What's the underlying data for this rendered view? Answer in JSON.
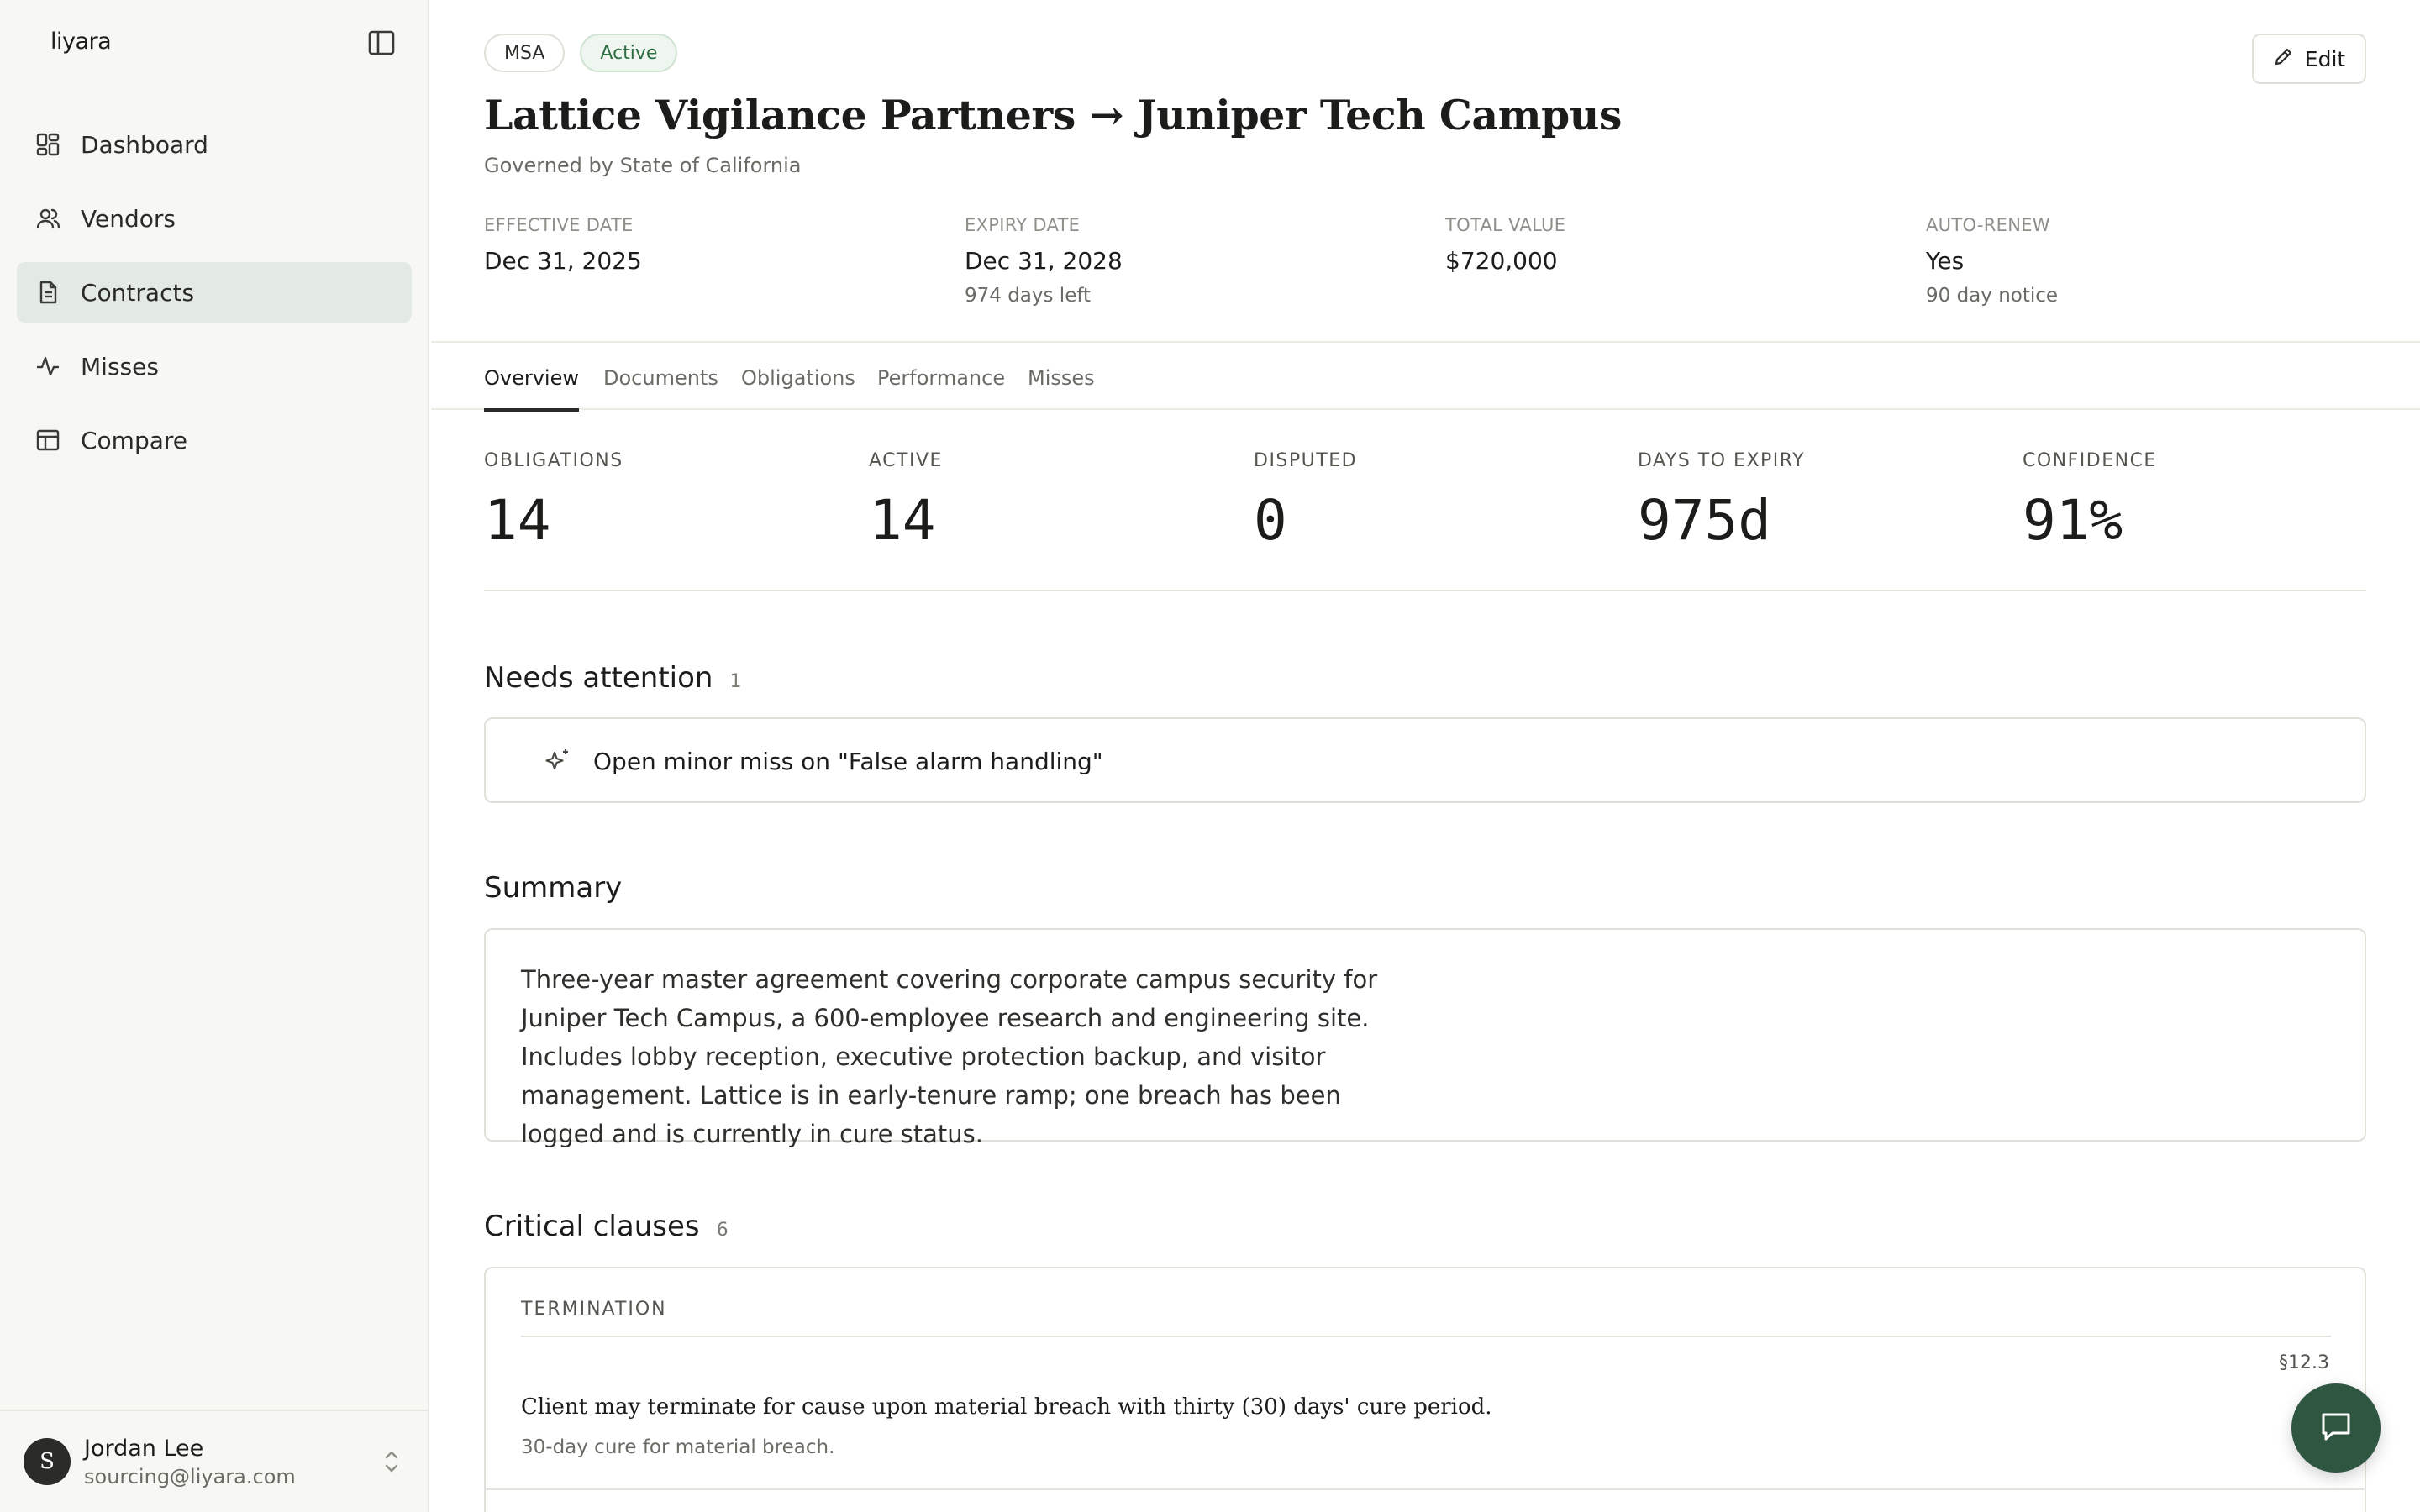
{
  "app": {
    "logo": "liyara"
  },
  "sidebar": {
    "items": [
      {
        "label": "Dashboard",
        "icon": "dashboard-icon"
      },
      {
        "label": "Vendors",
        "icon": "users-icon"
      },
      {
        "label": "Contracts",
        "icon": "document-icon",
        "active": true
      },
      {
        "label": "Misses",
        "icon": "activity-icon"
      },
      {
        "label": "Compare",
        "icon": "table-icon"
      }
    ],
    "user": {
      "initial": "S",
      "name": "Jordan Lee",
      "email": "sourcing@liyara.com"
    }
  },
  "header": {
    "badges": {
      "type": "MSA",
      "status": "Active"
    },
    "edit_label": "Edit",
    "title": "Lattice Vigilance Partners → Juniper Tech Campus",
    "subtitle": "Governed by State of California",
    "meta": {
      "effective": {
        "label": "EFFECTIVE DATE",
        "value": "Dec 31, 2025"
      },
      "expiry": {
        "label": "EXPIRY DATE",
        "value": "Dec 31, 2028",
        "sub": "974 days left"
      },
      "value": {
        "label": "TOTAL VALUE",
        "value": "$720,000"
      },
      "renew": {
        "label": "AUTO-RENEW",
        "value": "Yes",
        "sub": "90 day notice"
      }
    }
  },
  "tabs": [
    "Overview",
    "Documents",
    "Obligations",
    "Performance",
    "Misses"
  ],
  "stats": [
    {
      "label": "OBLIGATIONS",
      "value": "14"
    },
    {
      "label": "ACTIVE",
      "value": "14"
    },
    {
      "label": "DISPUTED",
      "value": "0"
    },
    {
      "label": "DAYS TO EXPIRY",
      "value": "975d"
    },
    {
      "label": "CONFIDENCE",
      "value": "91%"
    }
  ],
  "attention": {
    "title": "Needs attention",
    "count": "1",
    "item": "Open minor miss on \"False alarm handling\""
  },
  "summary": {
    "title": "Summary",
    "text": "Three-year master agreement covering corporate campus security for Juniper Tech Campus, a 600-employee research and engineering site. Includes lobby reception, executive protection backup, and visitor management. Lattice is in early-tenure ramp; one breach has been logged and is currently in cure status."
  },
  "clauses": {
    "title": "Critical clauses",
    "count": "6",
    "items": [
      {
        "kicker": "TERMINATION",
        "ref": "§12.3",
        "text": "Client may terminate for cause upon material breach with thirty (30) days' cure period.",
        "note": "30-day cure for material breach."
      }
    ]
  },
  "colors": {
    "accent": "#2f5640",
    "active_nav": "#e3e9e3",
    "active_badge": "#2f6d44"
  }
}
